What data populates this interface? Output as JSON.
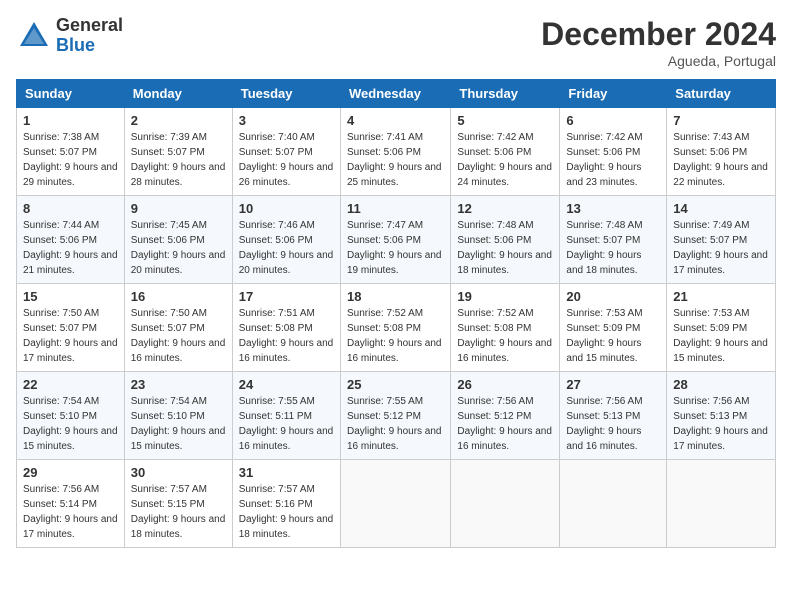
{
  "header": {
    "logo_general": "General",
    "logo_blue": "Blue",
    "title": "December 2024",
    "location": "Agueda, Portugal"
  },
  "weekdays": [
    "Sunday",
    "Monday",
    "Tuesday",
    "Wednesday",
    "Thursday",
    "Friday",
    "Saturday"
  ],
  "weeks": [
    [
      {
        "day": "1",
        "sunrise": "Sunrise: 7:38 AM",
        "sunset": "Sunset: 5:07 PM",
        "daylight": "Daylight: 9 hours and 29 minutes."
      },
      {
        "day": "2",
        "sunrise": "Sunrise: 7:39 AM",
        "sunset": "Sunset: 5:07 PM",
        "daylight": "Daylight: 9 hours and 28 minutes."
      },
      {
        "day": "3",
        "sunrise": "Sunrise: 7:40 AM",
        "sunset": "Sunset: 5:07 PM",
        "daylight": "Daylight: 9 hours and 26 minutes."
      },
      {
        "day": "4",
        "sunrise": "Sunrise: 7:41 AM",
        "sunset": "Sunset: 5:06 PM",
        "daylight": "Daylight: 9 hours and 25 minutes."
      },
      {
        "day": "5",
        "sunrise": "Sunrise: 7:42 AM",
        "sunset": "Sunset: 5:06 PM",
        "daylight": "Daylight: 9 hours and 24 minutes."
      },
      {
        "day": "6",
        "sunrise": "Sunrise: 7:42 AM",
        "sunset": "Sunset: 5:06 PM",
        "daylight": "Daylight: 9 hours and 23 minutes."
      },
      {
        "day": "7",
        "sunrise": "Sunrise: 7:43 AM",
        "sunset": "Sunset: 5:06 PM",
        "daylight": "Daylight: 9 hours and 22 minutes."
      }
    ],
    [
      {
        "day": "8",
        "sunrise": "Sunrise: 7:44 AM",
        "sunset": "Sunset: 5:06 PM",
        "daylight": "Daylight: 9 hours and 21 minutes."
      },
      {
        "day": "9",
        "sunrise": "Sunrise: 7:45 AM",
        "sunset": "Sunset: 5:06 PM",
        "daylight": "Daylight: 9 hours and 20 minutes."
      },
      {
        "day": "10",
        "sunrise": "Sunrise: 7:46 AM",
        "sunset": "Sunset: 5:06 PM",
        "daylight": "Daylight: 9 hours and 20 minutes."
      },
      {
        "day": "11",
        "sunrise": "Sunrise: 7:47 AM",
        "sunset": "Sunset: 5:06 PM",
        "daylight": "Daylight: 9 hours and 19 minutes."
      },
      {
        "day": "12",
        "sunrise": "Sunrise: 7:48 AM",
        "sunset": "Sunset: 5:06 PM",
        "daylight": "Daylight: 9 hours and 18 minutes."
      },
      {
        "day": "13",
        "sunrise": "Sunrise: 7:48 AM",
        "sunset": "Sunset: 5:07 PM",
        "daylight": "Daylight: 9 hours and 18 minutes."
      },
      {
        "day": "14",
        "sunrise": "Sunrise: 7:49 AM",
        "sunset": "Sunset: 5:07 PM",
        "daylight": "Daylight: 9 hours and 17 minutes."
      }
    ],
    [
      {
        "day": "15",
        "sunrise": "Sunrise: 7:50 AM",
        "sunset": "Sunset: 5:07 PM",
        "daylight": "Daylight: 9 hours and 17 minutes."
      },
      {
        "day": "16",
        "sunrise": "Sunrise: 7:50 AM",
        "sunset": "Sunset: 5:07 PM",
        "daylight": "Daylight: 9 hours and 16 minutes."
      },
      {
        "day": "17",
        "sunrise": "Sunrise: 7:51 AM",
        "sunset": "Sunset: 5:08 PM",
        "daylight": "Daylight: 9 hours and 16 minutes."
      },
      {
        "day": "18",
        "sunrise": "Sunrise: 7:52 AM",
        "sunset": "Sunset: 5:08 PM",
        "daylight": "Daylight: 9 hours and 16 minutes."
      },
      {
        "day": "19",
        "sunrise": "Sunrise: 7:52 AM",
        "sunset": "Sunset: 5:08 PM",
        "daylight": "Daylight: 9 hours and 16 minutes."
      },
      {
        "day": "20",
        "sunrise": "Sunrise: 7:53 AM",
        "sunset": "Sunset: 5:09 PM",
        "daylight": "Daylight: 9 hours and 15 minutes."
      },
      {
        "day": "21",
        "sunrise": "Sunrise: 7:53 AM",
        "sunset": "Sunset: 5:09 PM",
        "daylight": "Daylight: 9 hours and 15 minutes."
      }
    ],
    [
      {
        "day": "22",
        "sunrise": "Sunrise: 7:54 AM",
        "sunset": "Sunset: 5:10 PM",
        "daylight": "Daylight: 9 hours and 15 minutes."
      },
      {
        "day": "23",
        "sunrise": "Sunrise: 7:54 AM",
        "sunset": "Sunset: 5:10 PM",
        "daylight": "Daylight: 9 hours and 15 minutes."
      },
      {
        "day": "24",
        "sunrise": "Sunrise: 7:55 AM",
        "sunset": "Sunset: 5:11 PM",
        "daylight": "Daylight: 9 hours and 16 minutes."
      },
      {
        "day": "25",
        "sunrise": "Sunrise: 7:55 AM",
        "sunset": "Sunset: 5:12 PM",
        "daylight": "Daylight: 9 hours and 16 minutes."
      },
      {
        "day": "26",
        "sunrise": "Sunrise: 7:56 AM",
        "sunset": "Sunset: 5:12 PM",
        "daylight": "Daylight: 9 hours and 16 minutes."
      },
      {
        "day": "27",
        "sunrise": "Sunrise: 7:56 AM",
        "sunset": "Sunset: 5:13 PM",
        "daylight": "Daylight: 9 hours and 16 minutes."
      },
      {
        "day": "28",
        "sunrise": "Sunrise: 7:56 AM",
        "sunset": "Sunset: 5:13 PM",
        "daylight": "Daylight: 9 hours and 17 minutes."
      }
    ],
    [
      {
        "day": "29",
        "sunrise": "Sunrise: 7:56 AM",
        "sunset": "Sunset: 5:14 PM",
        "daylight": "Daylight: 9 hours and 17 minutes."
      },
      {
        "day": "30",
        "sunrise": "Sunrise: 7:57 AM",
        "sunset": "Sunset: 5:15 PM",
        "daylight": "Daylight: 9 hours and 18 minutes."
      },
      {
        "day": "31",
        "sunrise": "Sunrise: 7:57 AM",
        "sunset": "Sunset: 5:16 PM",
        "daylight": "Daylight: 9 hours and 18 minutes."
      },
      null,
      null,
      null,
      null
    ]
  ]
}
